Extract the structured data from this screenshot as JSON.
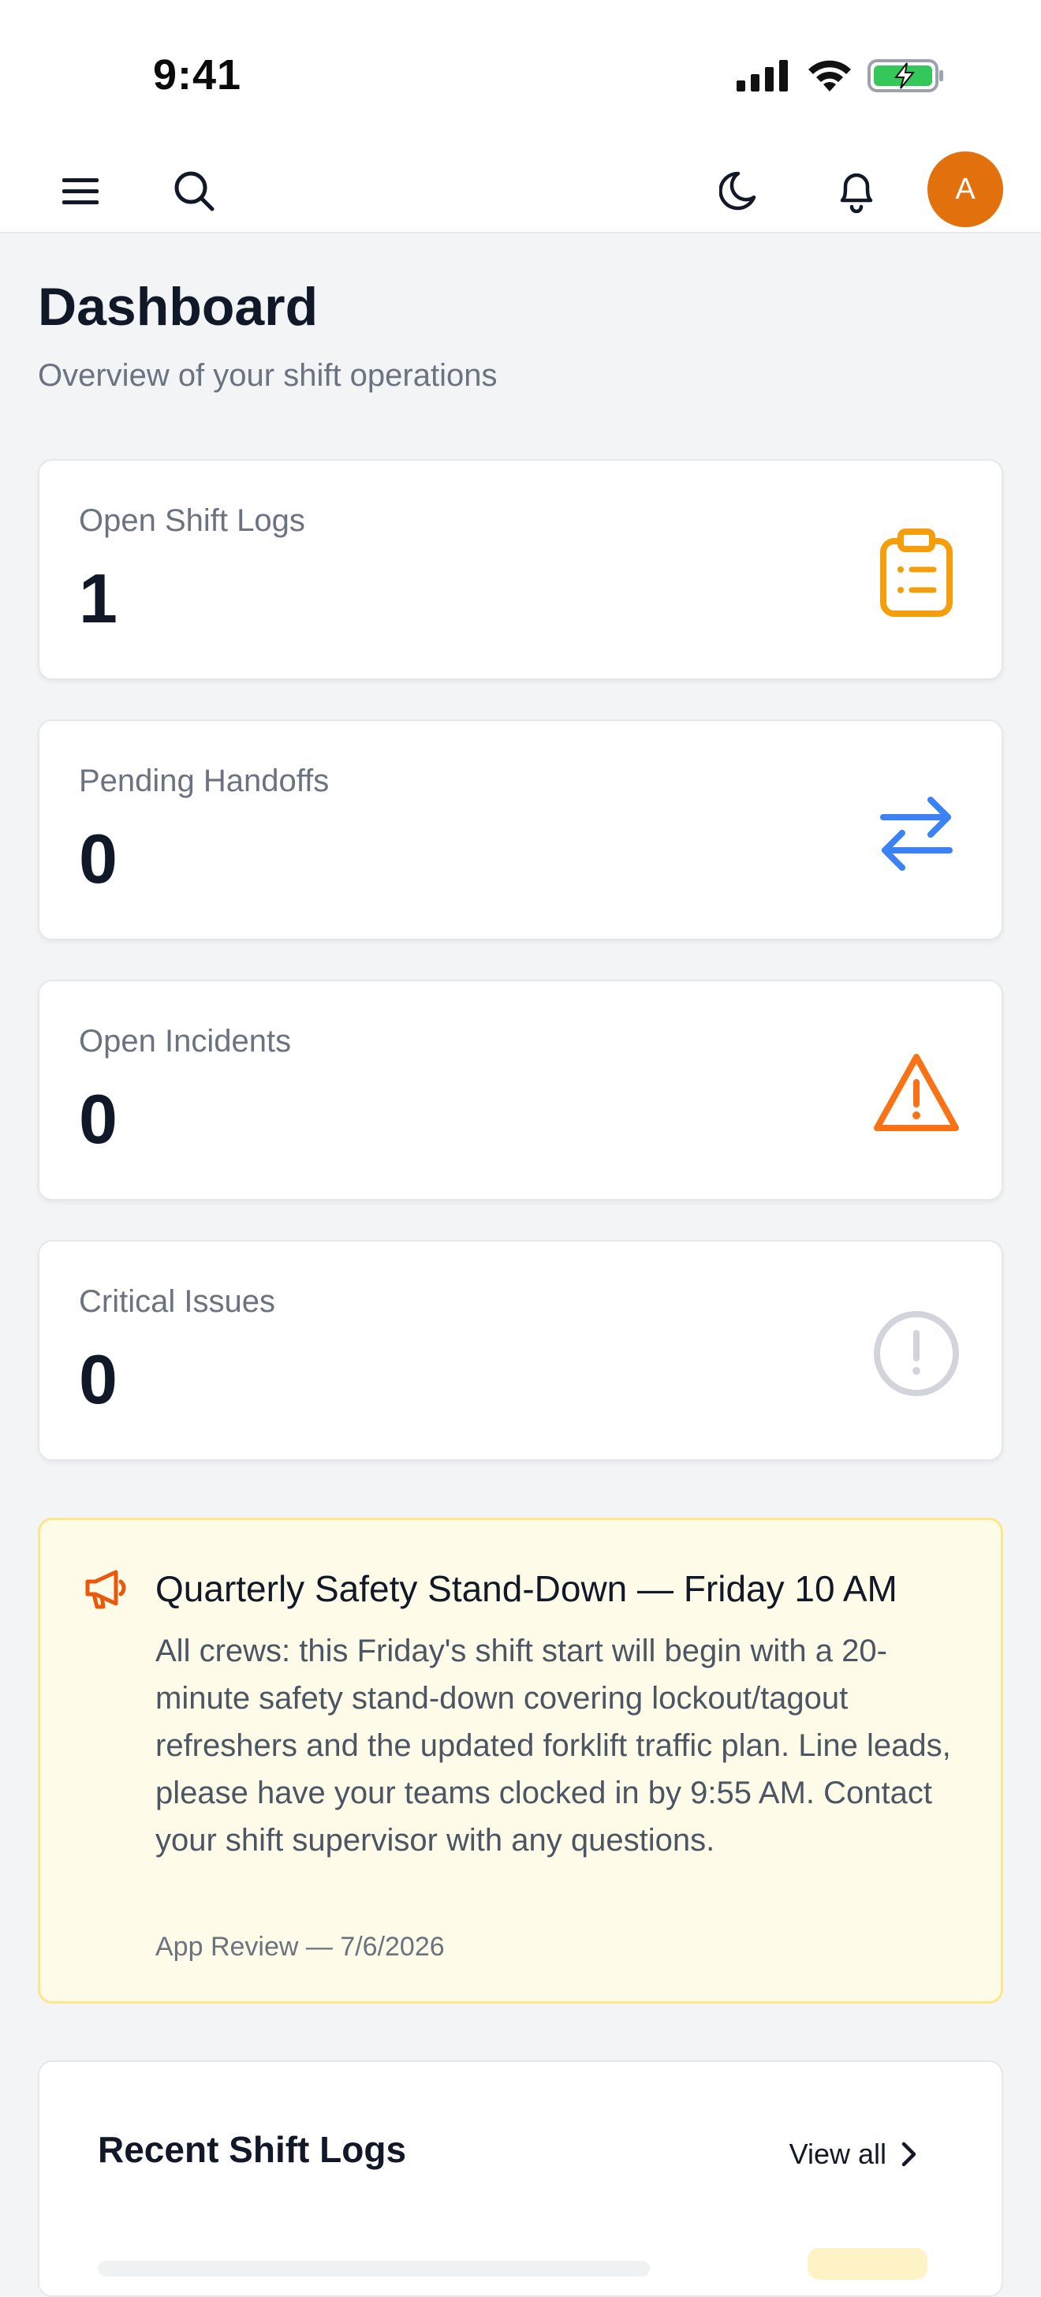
{
  "status_bar": {
    "time": "9:41",
    "icons": [
      "signal-icon",
      "wifi-icon",
      "battery-charging-icon"
    ]
  },
  "topbar": {
    "avatar_initial": "A",
    "avatar_color": "#e2700c"
  },
  "page": {
    "title": "Dashboard",
    "subtitle": "Overview of your shift operations"
  },
  "stats": [
    {
      "label": "Open Shift Logs",
      "value": "1",
      "icon": "clipboard-list-icon",
      "color": "#f59e0b"
    },
    {
      "label": "Pending Handoffs",
      "value": "0",
      "icon": "arrows-exchange-icon",
      "color": "#3b82f6"
    },
    {
      "label": "Open Incidents",
      "value": "0",
      "icon": "warning-triangle-icon",
      "color": "#f97316"
    },
    {
      "label": "Critical Issues",
      "value": "0",
      "icon": "alert-circle-icon",
      "color": "#d1d5db"
    }
  ],
  "announcement": {
    "title": "Quarterly Safety Stand-Down — Friday 10 AM",
    "body": "All crews: this Friday's shift start will begin with a 20-minute safety stand-down covering lockout/tagout refreshers and the updated forklift traffic plan. Line leads, please have your teams clocked in by 9:55 AM. Contact your shift supervisor with any questions.",
    "meta": "App Review — 7/6/2026",
    "icon": "megaphone-icon"
  },
  "recent": {
    "title": "Recent Shift Logs",
    "view_all": "View all"
  }
}
